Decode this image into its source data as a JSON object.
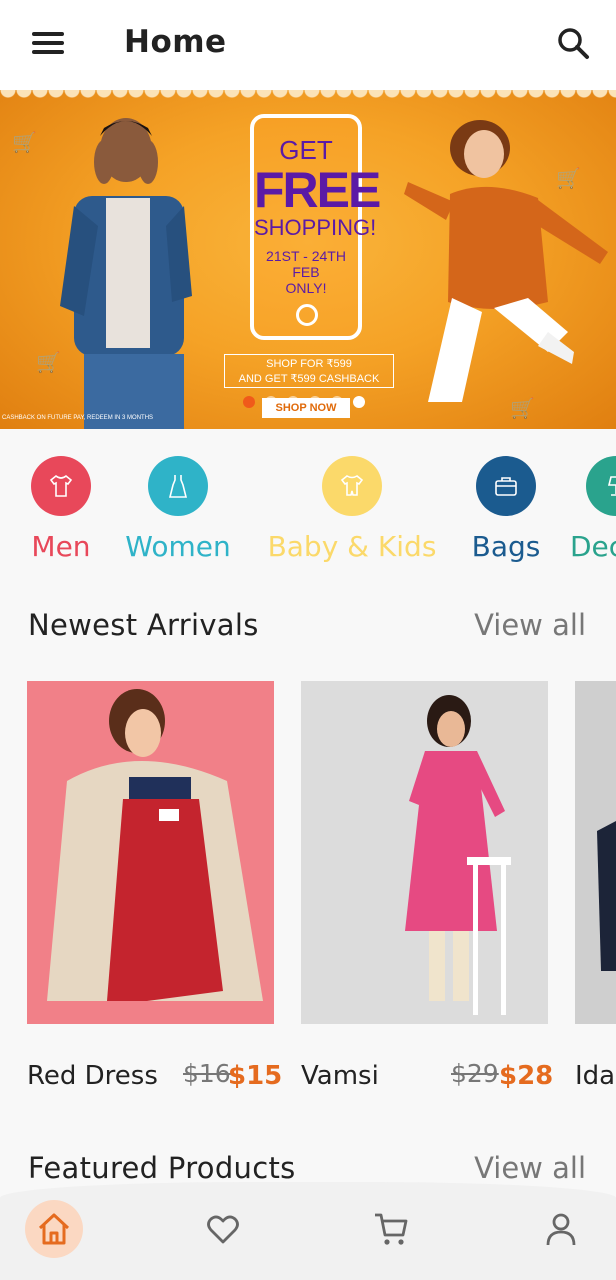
{
  "app_bar": {
    "title": "Home",
    "menu_icon": "hamburger-menu-icon",
    "search_icon": "search-icon"
  },
  "banner": {
    "headline_get": "GET",
    "headline_free": "FREE",
    "headline_shopping": "SHOPPING!",
    "dates": "21ST - 24TH FEB",
    "only": "ONLY!",
    "offer_line1": "SHOP FOR ₹599",
    "offer_line2": "AND GET ₹599 CASHBACK",
    "cta": "SHOP NOW",
    "fineprint": "CASHBACK ON FUTURE PAY, REDEEM IN 3 MONTHS",
    "slide_count": 6,
    "active_slide": 1
  },
  "categories": [
    {
      "label": "Men",
      "color": "#e8485a",
      "icon": "tshirt-icon"
    },
    {
      "label": "Women",
      "color": "#2fb3c8",
      "icon": "dress-icon"
    },
    {
      "label": "Baby & Kids",
      "color": "#fbd96a",
      "icon": "baby-clothes-icon"
    },
    {
      "label": "Bags",
      "color": "#1b5b8f",
      "icon": "briefcase-icon"
    },
    {
      "label": "Decor",
      "color": "#2aa38d",
      "icon": "lamp-icon"
    }
  ],
  "newest_arrivals": {
    "title": "Newest Arrivals",
    "view_all": "View all",
    "products": [
      {
        "name": "Red Dress",
        "old_price": "$16",
        "price": "$15"
      },
      {
        "name": "Vamsi",
        "old_price": "$29",
        "price": "$28"
      },
      {
        "name": "Ida",
        "old_price": "",
        "price": ""
      }
    ]
  },
  "featured_products": {
    "title": "Featured Products",
    "view_all": "View all"
  },
  "bottom_nav": [
    {
      "icon": "home-icon",
      "active": true
    },
    {
      "icon": "heart-icon",
      "active": false
    },
    {
      "icon": "cart-icon",
      "active": false
    },
    {
      "icon": "profile-icon",
      "active": false
    }
  ],
  "colors": {
    "accent": "#e56b1f",
    "banner_orange": "#f5a226",
    "headline_purple": "#5b1aa6"
  }
}
